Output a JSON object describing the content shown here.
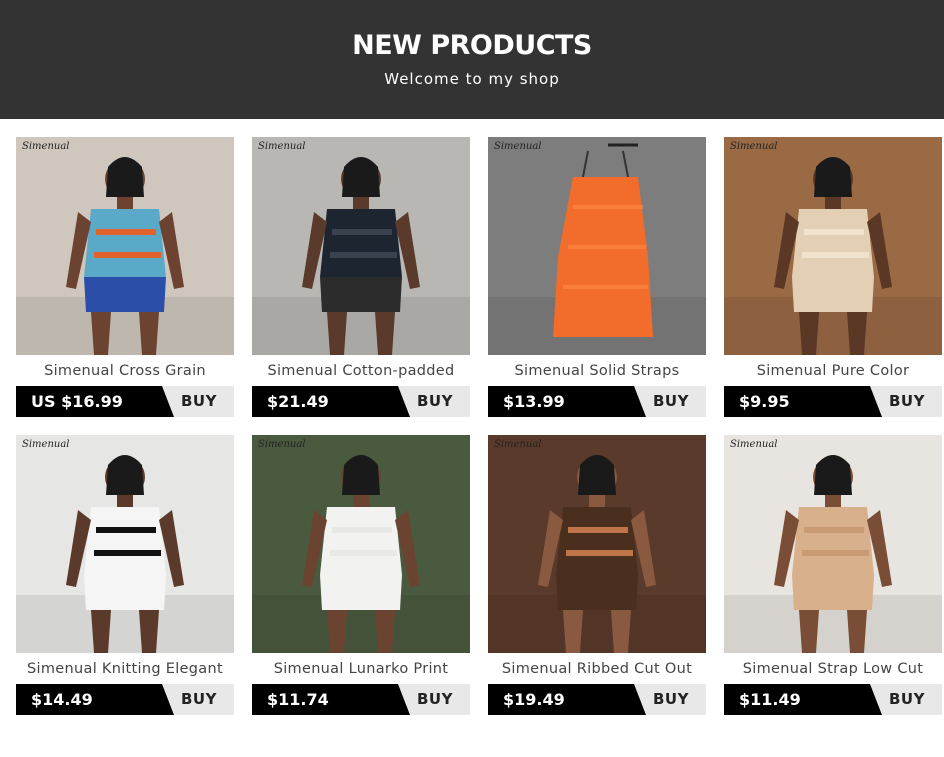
{
  "header": {
    "title": "NEW PRODUCTS",
    "subtitle": "Welcome to my shop"
  },
  "watermark": "Simenual",
  "buy_label": "BUY",
  "products": [
    {
      "name": "Simenual Cross Grain",
      "price": "US $16.99",
      "colors": {
        "bg": "#cfc7bd",
        "skin": "#6b4330",
        "top": "#5aa9c9",
        "accent": "#e2622e",
        "bottom": "#2b4fa8"
      }
    },
    {
      "name": "Simenual Cotton-padded",
      "price": "$21.49",
      "colors": {
        "bg": "#b9b7b3",
        "skin": "#5a3a2a",
        "top": "#1d2530",
        "accent": "#3a4250",
        "bottom": "#2c2c2c"
      }
    },
    {
      "name": "Simenual Solid Straps",
      "price": "$13.99",
      "colors": {
        "bg": "#7d7d7d",
        "skin": "#7d7d7d",
        "top": "#f26d2b",
        "accent": "#ff8a45",
        "bottom": "#f26d2b"
      }
    },
    {
      "name": "Simenual Pure Color",
      "price": "$9.95",
      "colors": {
        "bg": "#9a6a45",
        "skin": "#5b3826",
        "top": "#e3cfb3",
        "accent": "#f0e2cc",
        "bottom": "#e3cfb3"
      }
    },
    {
      "name": "Simenual Knitting Elegant",
      "price": "$14.49",
      "colors": {
        "bg": "#e6e6e4",
        "skin": "#5b3a2c",
        "top": "#f5f5f5",
        "accent": "#111111",
        "bottom": "#f5f5f5"
      }
    },
    {
      "name": "Simenual Lunarko Print",
      "price": "$11.74",
      "colors": {
        "bg": "#4a5a3e",
        "skin": "#6b4431",
        "top": "#f2f2f0",
        "accent": "#e8e8e6",
        "bottom": "#f2f2f0"
      }
    },
    {
      "name": "Simenual Ribbed Cut Out",
      "price": "$19.49",
      "colors": {
        "bg": "#5a3a2a",
        "skin": "#8a5a40",
        "top": "#4a2f1e",
        "accent": "#c0744a",
        "bottom": "#4a2f1e"
      }
    },
    {
      "name": "Simenual Strap Low Cut",
      "price": "$11.49",
      "colors": {
        "bg": "#e8e4df",
        "skin": "#7a4e36",
        "top": "#d9b08c",
        "accent": "#c99b74",
        "bottom": "#d9b08c"
      }
    }
  ]
}
